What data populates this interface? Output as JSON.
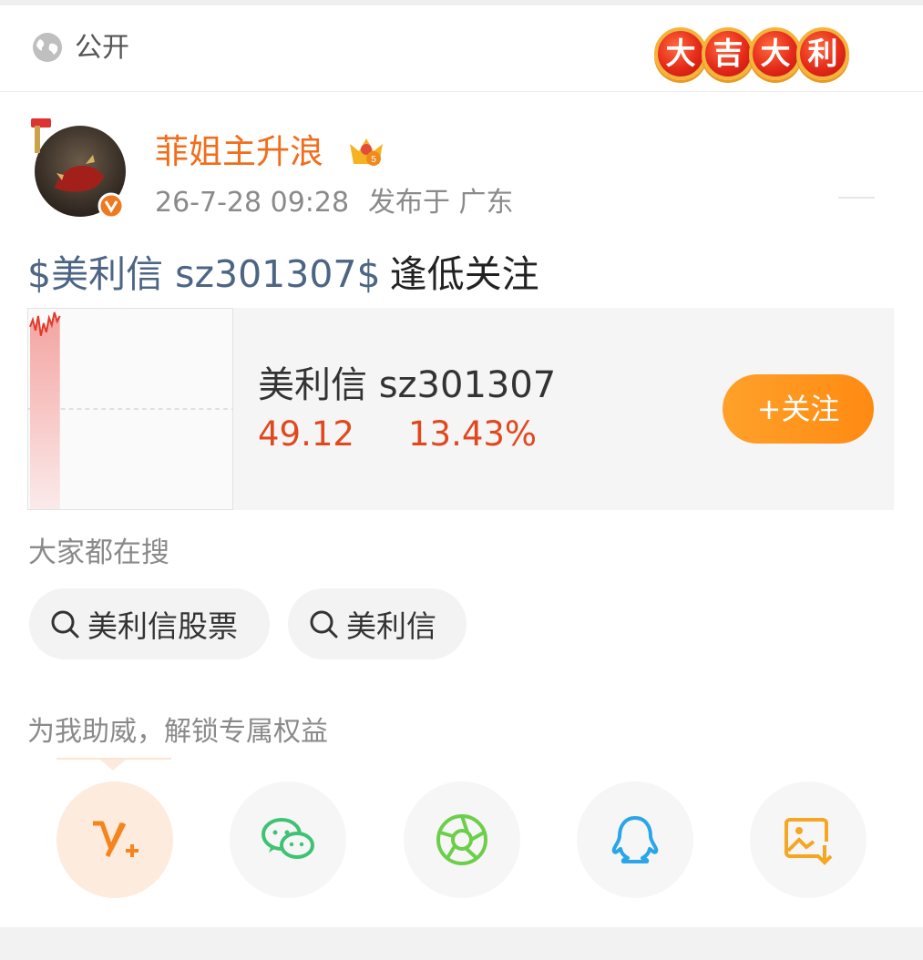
{
  "header": {
    "privacy_label": "公开",
    "badge_chars": [
      "大",
      "吉",
      "大",
      "利"
    ]
  },
  "post": {
    "author": "菲姐主升浪",
    "time": "26-7-28 09:28",
    "location": "发布于 广东",
    "tag": "$美利信 sz301307$",
    "body": "逢低关注"
  },
  "stock_card": {
    "name": "美利信 sz301307",
    "price": "49.12",
    "change": "13.43%",
    "follow_label": "+关注"
  },
  "search": {
    "heading": "大家都在搜",
    "chips": [
      {
        "label": "美利信股票"
      },
      {
        "label": "美利信"
      }
    ]
  },
  "support": {
    "text": "为我助威，解锁专属权益"
  },
  "share_targets": [
    "v-plus-icon",
    "wechat-icon",
    "moments-icon",
    "qq-icon",
    "save-image-icon"
  ],
  "colors": {
    "username": "#f26d1a",
    "stock_up": "#e0491e",
    "tag_link": "#4d6585",
    "follow_button": "#ff9a1f"
  }
}
